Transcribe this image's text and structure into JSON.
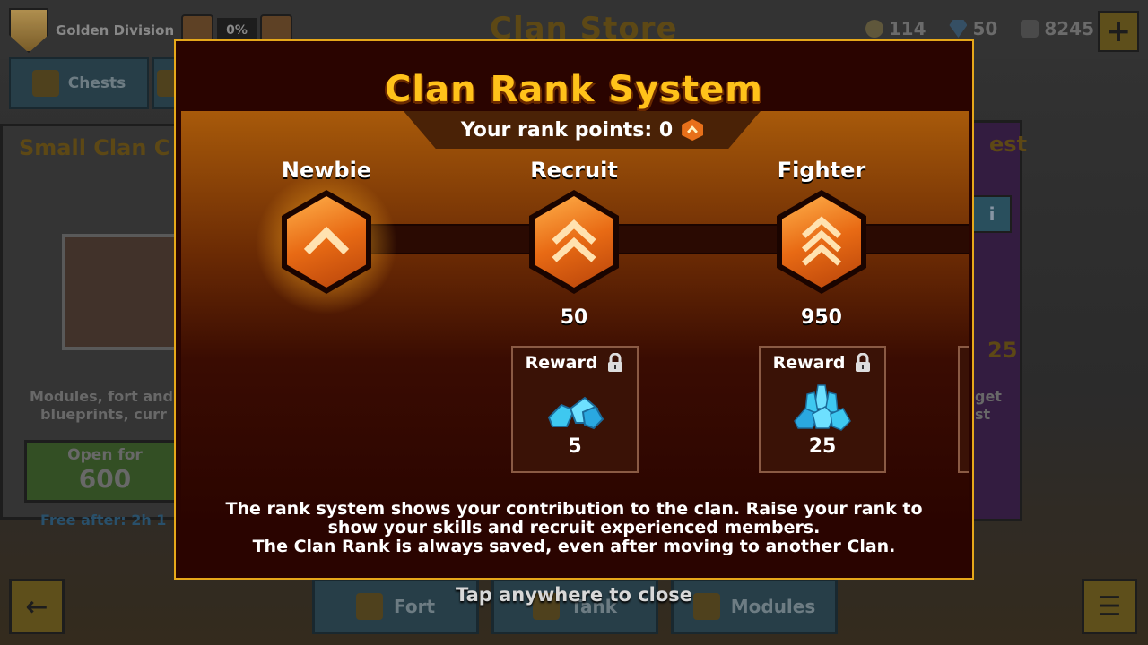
{
  "header": {
    "division_name": "Golden Division",
    "division_progress": "0%",
    "store_title": "Clan Store",
    "currencies": [
      {
        "icon": "coin-icon",
        "value": "114"
      },
      {
        "icon": "gem-icon",
        "value": "50"
      },
      {
        "icon": "coupon-icon",
        "value": "8245"
      }
    ],
    "add_label": "+"
  },
  "tabs": [
    {
      "label": "Chests",
      "icon": "chest-tab-icon"
    },
    {
      "label": "",
      "icon": "tower-tab-icon"
    }
  ],
  "left_card": {
    "title": "Small Clan C",
    "desc_line1": "Modules, fort and",
    "desc_line2": "blueprints, curr",
    "open_label": "Open for",
    "price": "600",
    "free_after": "Free after: 2h 1"
  },
  "right_card": {
    "title": "est",
    "info_label": "i",
    "number": "25",
    "desc_line1": "get",
    "desc_line2": "st"
  },
  "bottom_nav": [
    {
      "label": "Fort",
      "icon": "castle-icon"
    },
    {
      "label": "Tank",
      "icon": "tank-icon"
    },
    {
      "label": "Modules",
      "icon": "module-icon"
    }
  ],
  "back_label": "←",
  "menu_label": "☰",
  "modal": {
    "title": "Clan Rank System",
    "points_label": "Your rank points: 0",
    "ranks": [
      {
        "name": "Newbie",
        "chevrons": 1,
        "active": true,
        "requirement": "",
        "reward": null
      },
      {
        "name": "Recruit",
        "chevrons": 2,
        "active": false,
        "requirement": "50",
        "reward": {
          "label": "Reward",
          "amount": "5",
          "icon": "small-gem-pile-icon"
        }
      },
      {
        "name": "Fighter",
        "chevrons": 3,
        "active": false,
        "requirement": "950",
        "reward": {
          "label": "Reward",
          "amount": "25",
          "icon": "large-gem-pile-icon"
        }
      }
    ],
    "description_line1": "The rank system shows your contribution to the clan. Raise your rank to",
    "description_line2": "show your skills and recruit experienced members.",
    "description_line3": "The Clan Rank is always saved, even after moving to another Clan."
  },
  "tap_to_close": "Tap anywhere to close",
  "colors": {
    "title_gold": "#ffc21a",
    "modal_border": "#e6a81a",
    "badge_orange": "#e86a14",
    "gem_blue": "#3ec8f0"
  }
}
